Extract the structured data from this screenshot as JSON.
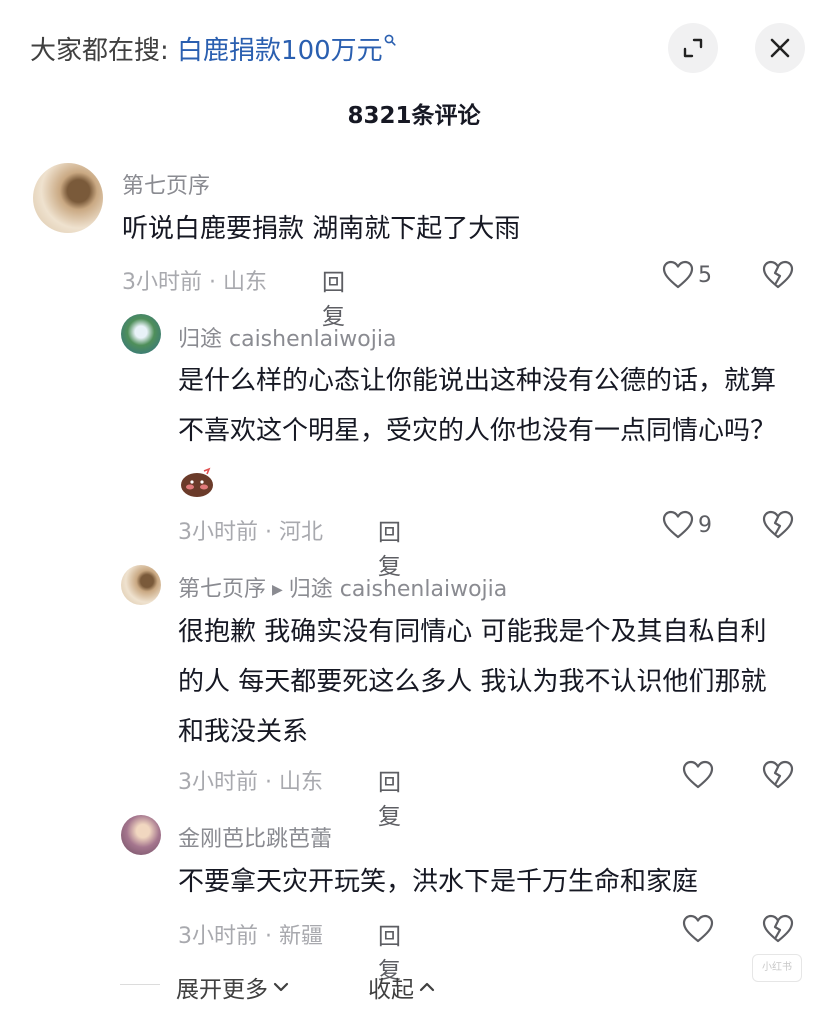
{
  "header": {
    "search_prefix": "大家都在搜: ",
    "search_keyword": "白鹿捐款100万元",
    "comment_count": "8321条评论"
  },
  "comments": [
    {
      "user": "第七页序",
      "text": "听说白鹿要捐款 湖南就下起了大雨",
      "meta": "3小时前 · 山东",
      "reply_label": "回复",
      "likes": "5"
    },
    {
      "user": "归途 caishenlaiwojia",
      "text": "是什么样的心态让你能说出这种没有公德的话，就算不喜欢这个明星，受灾的人你也没有一点同情心吗？",
      "meta": "3小时前 · 河北",
      "reply_label": "回复",
      "likes": "9"
    },
    {
      "user": "第七页序",
      "reply_to": "归途 caishenlaiwojia",
      "text": "很抱歉 我确实没有同情心 可能我是个及其自私自利的人 每天都要死这么多人 我认为我不认识他们那就和我没关系",
      "meta": "3小时前 · 山东",
      "reply_label": "回复",
      "likes": ""
    },
    {
      "user": "金刚芭比跳芭蕾",
      "text": "不要拿天灾开玩笑，洪水下是千万生命和家庭",
      "meta": "3小时前 · 新疆",
      "reply_label": "回复",
      "likes": ""
    }
  ],
  "footer": {
    "expand_more": "展开更多",
    "collapse": "收起",
    "watermark": "小红书"
  },
  "colors": {
    "keyword": "#2a5fb0",
    "meta": "#a8a9ae",
    "username": "#8a8b91"
  }
}
